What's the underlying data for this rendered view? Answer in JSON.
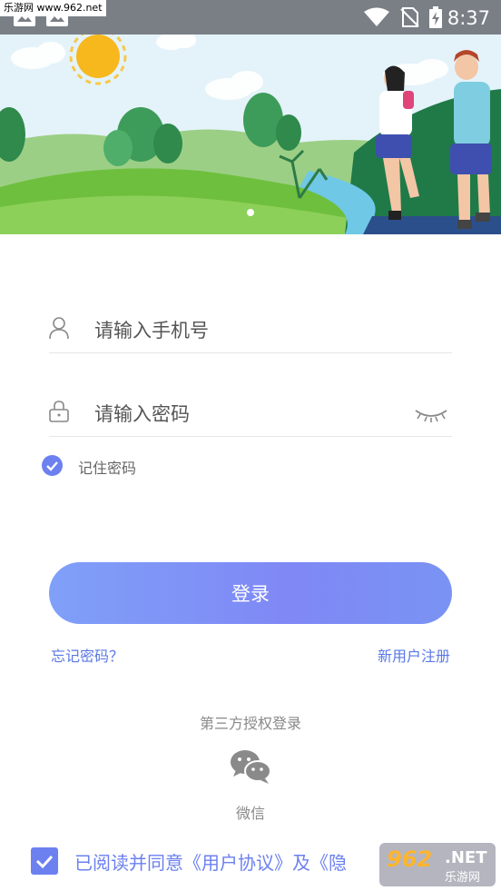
{
  "status_bar": {
    "watermark": "乐游网 www.962.net",
    "time": "8:37"
  },
  "login": {
    "phone_placeholder": "请输入手机号",
    "password_placeholder": "请输入密码",
    "remember_label": "记住密码",
    "remember_checked": true,
    "login_button": "登录",
    "forgot_password": "忘记密码？",
    "register": "新用户注册"
  },
  "third_party": {
    "title": "第三方授权登录",
    "wechat_label": "微信"
  },
  "agreement": {
    "text": "已阅读并同意《用户协议》及《隐",
    "checked": true
  },
  "watermark_bottom": {
    "number": "962",
    "suffix": ".NET",
    "site": "乐游网"
  },
  "colors": {
    "accent": "#6c80f0",
    "button_start": "#7fa0f8",
    "button_end": "#7a93f3"
  }
}
